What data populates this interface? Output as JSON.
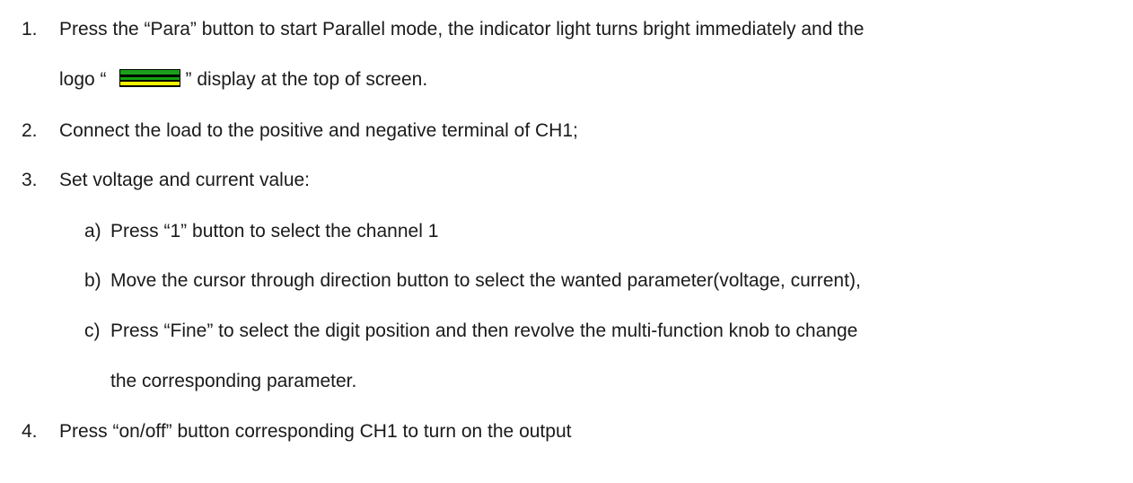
{
  "steps": [
    {
      "number": "1.",
      "line1": "Press the “Para” button to start Parallel mode, the indicator light turns bright immediately and the",
      "line2_prefix": "logo “",
      "line2_suffix": "” display at the top of screen."
    },
    {
      "number": "2.",
      "text": "Connect the load to the positive and negative terminal of CH1;"
    },
    {
      "number": "3.",
      "text": "Set voltage and current value:",
      "substeps": [
        {
          "letter": "a)",
          "text": "Press “1” button to select the channel 1"
        },
        {
          "letter": "b)",
          "text": "Move the cursor through direction button to select the wanted parameter(voltage, current),"
        },
        {
          "letter": "c)",
          "line1": "Press “Fine” to select the digit position and then revolve the multi-function knob to change",
          "line2": "the corresponding parameter."
        }
      ]
    },
    {
      "number": "4.",
      "text": "Press “on/off” button corresponding CH1 to turn on the output"
    }
  ],
  "logo": {
    "icon": "parallel-mode-logo-icon",
    "colors": [
      "#1aa01a",
      "#000000",
      "#f2f200"
    ]
  }
}
